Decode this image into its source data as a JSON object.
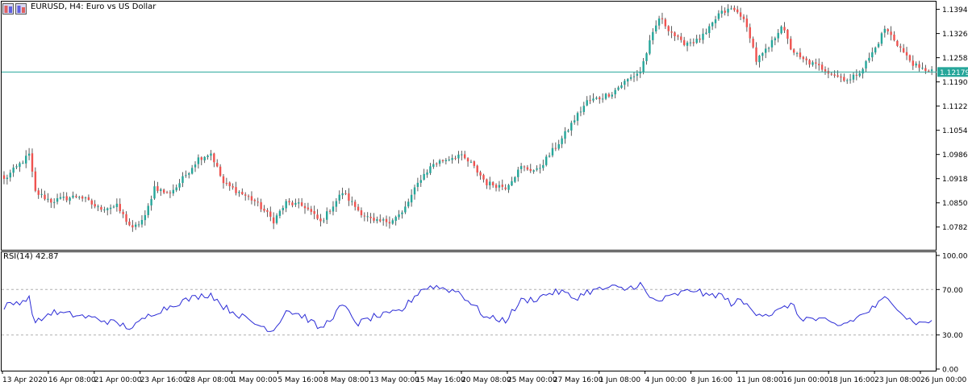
{
  "header": {
    "symbol": "EURUSD, H4:",
    "description": "Euro vs US Dollar"
  },
  "colors": {
    "bull": "#26a69a",
    "bear": "#ef5350",
    "wick": "#333333",
    "rsi_line": "#2b2bd6",
    "price_line": "#26a69a",
    "level_line": "#b0b0b0",
    "axis": "#000000",
    "frame": "#000000"
  },
  "chart_data": [
    {
      "type": "candlestick",
      "title": "EURUSD, H4: Euro vs US Dollar",
      "ylim": [
        1.0718,
        1.1418
      ],
      "y_ticks": [
        "1.13940",
        "1.13260",
        "1.12580",
        "1.11900",
        "1.11220",
        "1.10540",
        "1.09860",
        "1.09180",
        "1.08500",
        "1.07820"
      ],
      "current_price_label": "1.12179",
      "current_price": 1.12179,
      "x_ticks": [
        "13 Apr 2020",
        "16 Apr 08:00",
        "21 Apr 00:00",
        "23 Apr 16:00",
        "28 Apr 08:00",
        "1 May 00:00",
        "5 May 16:00",
        "8 May 08:00",
        "13 May 00:00",
        "15 May 16:00",
        "20 May 08:00",
        "25 May 00:00",
        "27 May 16:00",
        "1 Jun 08:00",
        "4 Jun 00:00",
        "8 Jun 16:00",
        "11 Jun 08:00",
        "16 Jun 00:00",
        "18 Jun 16:00",
        "23 Jun 08:00",
        "26 Jun 00:00"
      ],
      "close_anchors": [
        [
          0,
          1.0915
        ],
        [
          8,
          1.0985
        ],
        [
          10,
          1.088
        ],
        [
          15,
          1.0855
        ],
        [
          24,
          1.087
        ],
        [
          30,
          1.0835
        ],
        [
          36,
          1.084
        ],
        [
          41,
          1.0775
        ],
        [
          45,
          1.081
        ],
        [
          48,
          1.0895
        ],
        [
          52,
          1.0875
        ],
        [
          55,
          1.0895
        ],
        [
          62,
          1.0975
        ],
        [
          66,
          1.099
        ],
        [
          70,
          1.0905
        ],
        [
          80,
          1.0855
        ],
        [
          86,
          1.08
        ],
        [
          90,
          1.085
        ],
        [
          96,
          1.084
        ],
        [
          101,
          1.0795
        ],
        [
          108,
          1.088
        ],
        [
          113,
          1.083
        ],
        [
          118,
          1.0795
        ],
        [
          123,
          1.08
        ],
        [
          127,
          1.082
        ],
        [
          133,
          1.092
        ],
        [
          137,
          1.096
        ],
        [
          145,
          1.0985
        ],
        [
          149,
          1.096
        ],
        [
          154,
          1.0905
        ],
        [
          160,
          1.0895
        ],
        [
          165,
          1.095
        ],
        [
          170,
          1.094
        ],
        [
          174,
          1.0985
        ],
        [
          178,
          1.103
        ],
        [
          182,
          1.1085
        ],
        [
          186,
          1.1135
        ],
        [
          190,
          1.1145
        ],
        [
          194,
          1.116
        ],
        [
          198,
          1.119
        ],
        [
          203,
          1.122
        ],
        [
          206,
          1.13
        ],
        [
          209,
          1.137
        ],
        [
          212,
          1.134
        ],
        [
          216,
          1.13
        ],
        [
          221,
          1.1305
        ],
        [
          224,
          1.1325
        ],
        [
          228,
          1.138
        ],
        [
          232,
          1.1395
        ],
        [
          235,
          1.138
        ],
        [
          238,
          1.132
        ],
        [
          240,
          1.125
        ],
        [
          244,
          1.1285
        ],
        [
          248,
          1.135
        ],
        [
          251,
          1.1285
        ],
        [
          254,
          1.1255
        ],
        [
          258,
          1.124
        ],
        [
          262,
          1.1225
        ],
        [
          266,
          1.1205
        ],
        [
          270,
          1.1195
        ],
        [
          274,
          1.123
        ],
        [
          278,
          1.1285
        ],
        [
          281,
          1.134
        ],
        [
          284,
          1.131
        ],
        [
          288,
          1.126
        ],
        [
          292,
          1.1225
        ],
        [
          296,
          1.1225
        ]
      ]
    },
    {
      "type": "line",
      "title": "RSI(14) 42.87",
      "ylim": [
        0,
        100
      ],
      "y_ticks": [
        "100.00",
        "70.00",
        "30.00",
        "0.00"
      ],
      "levels": [
        70,
        30
      ],
      "x": [
        0,
        8,
        10,
        15,
        24,
        30,
        36,
        41,
        45,
        48,
        52,
        55,
        62,
        66,
        70,
        80,
        86,
        90,
        96,
        101,
        108,
        113,
        118,
        123,
        127,
        133,
        137,
        145,
        149,
        154,
        160,
        165,
        170,
        174,
        178,
        182,
        186,
        190,
        194,
        198,
        203,
        206,
        209,
        212,
        216,
        221,
        224,
        228,
        232,
        235,
        238,
        240,
        244,
        248,
        251,
        254,
        258,
        262,
        266,
        270,
        274,
        278,
        281,
        284,
        288,
        292,
        296
      ],
      "values": [
        55,
        62,
        40,
        50,
        47,
        44,
        40,
        36,
        45,
        50,
        54,
        58,
        64,
        66,
        55,
        40,
        34,
        52,
        46,
        35,
        56,
        40,
        46,
        48,
        52,
        70,
        73,
        68,
        58,
        45,
        43,
        60,
        62,
        67,
        68,
        62,
        68,
        70,
        72,
        70,
        75,
        62,
        60,
        63,
        67,
        70,
        64,
        66,
        58,
        60,
        54,
        50,
        48,
        52,
        58,
        45,
        44,
        42,
        38,
        42,
        48,
        55,
        62,
        58,
        45,
        40,
        42.87
      ]
    }
  ]
}
